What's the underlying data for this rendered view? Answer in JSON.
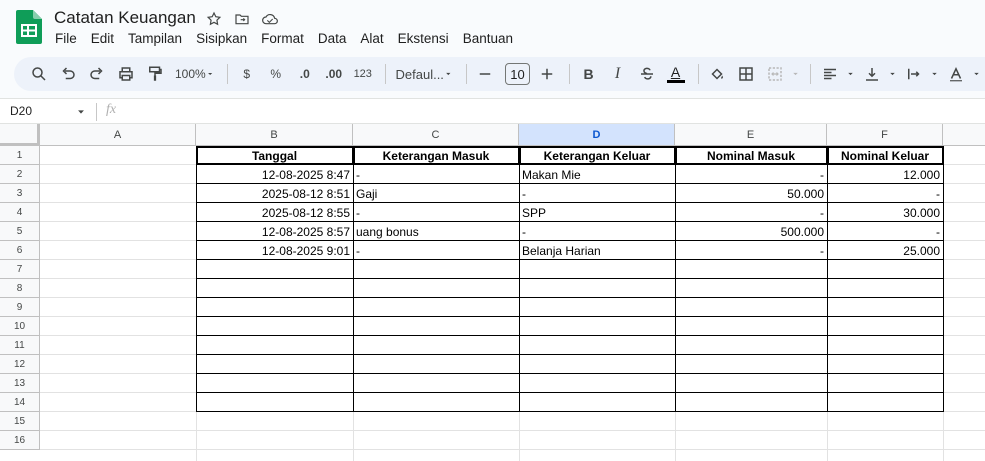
{
  "app": {
    "title": "Catatan Keuangan",
    "menu": [
      "File",
      "Edit",
      "Tampilan",
      "Sisipkan",
      "Format",
      "Data",
      "Alat",
      "Ekstensi",
      "Bantuan"
    ]
  },
  "toolbar": {
    "zoom": "100%",
    "currency": "$",
    "percent": "%",
    "dec_decrease": ".0",
    "dec_increase": ".00",
    "number_format": "123",
    "font": "Defaul...",
    "font_size": "10",
    "bold": "B",
    "italic": "I",
    "text_color_letter": "A"
  },
  "formula_bar": {
    "cell_ref": "D20",
    "fx": "fx"
  },
  "columns": [
    "A",
    "B",
    "C",
    "D",
    "E",
    "F"
  ],
  "selected_column": "D",
  "row_numbers": [
    "1",
    "2",
    "3",
    "4",
    "5",
    "6",
    "7",
    "8",
    "9",
    "10",
    "11",
    "12",
    "13",
    "14",
    "15",
    "16"
  ],
  "table": {
    "headers": [
      "Tanggal",
      "Keterangan Masuk",
      "Keterangan Keluar",
      "Nominal Masuk",
      "Nominal Keluar"
    ],
    "rows": [
      [
        "12-08-2025 8:47",
        "-",
        "Makan Mie",
        "-",
        "12.000"
      ],
      [
        "2025-08-12 8:51",
        "Gaji",
        "-",
        "50.000",
        "-"
      ],
      [
        "2025-08-12 8:55",
        "-",
        "SPP",
        "-",
        "30.000"
      ],
      [
        "12-08-2025 8:57",
        "uang bonus",
        "-",
        "500.000",
        "-"
      ],
      [
        "12-08-2025 9:01",
        "-",
        "Belanja Harian",
        "-",
        "25.000"
      ]
    ]
  },
  "colors": {
    "sheets_green": "#0f9d58",
    "selected_header": "#d3e3fd",
    "toolbar_bg": "#edf2fa"
  }
}
